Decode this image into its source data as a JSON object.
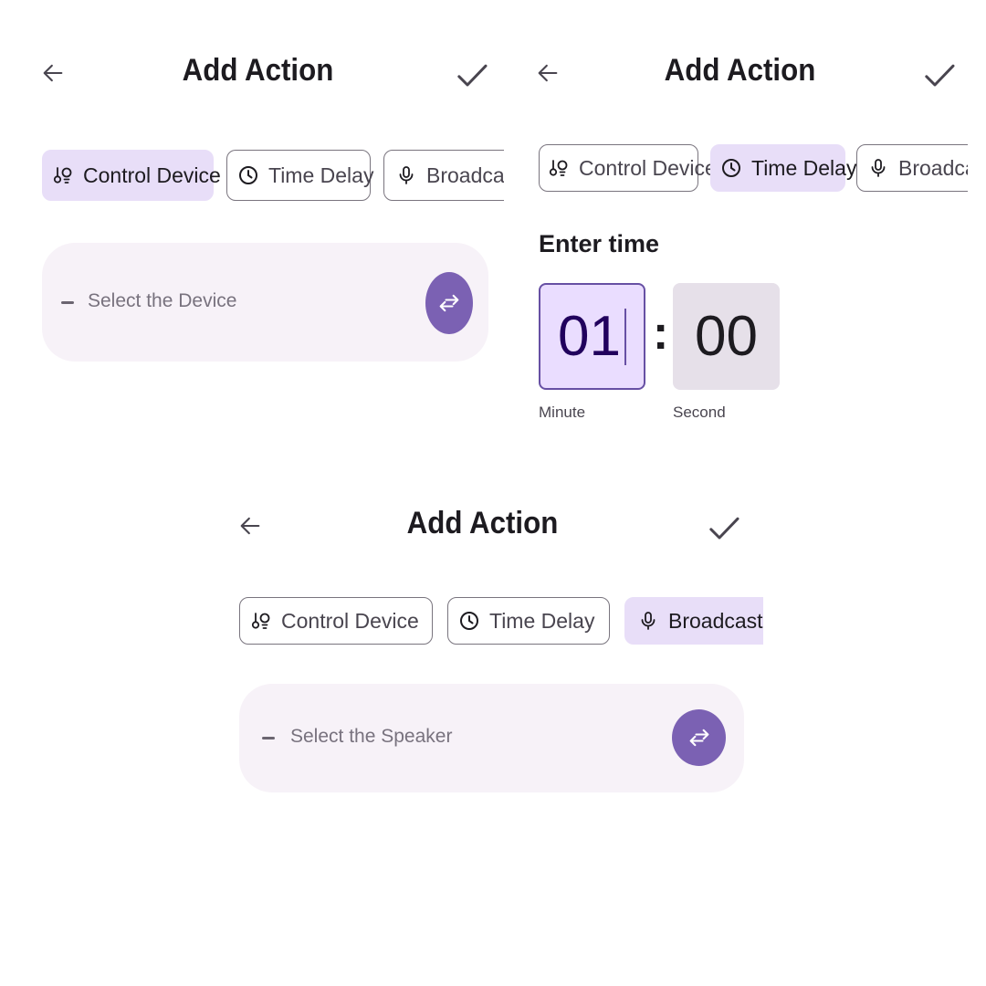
{
  "colors": {
    "chip_selected": "#e8def8",
    "fab": "#7b61b3",
    "card": "#f7f2f8",
    "time_active": "#eaddff",
    "time_inactive": "#e6e0e9"
  },
  "screens": [
    {
      "title": "Add Action",
      "back_icon": "arrow-back-icon",
      "confirm_icon": "checkmark-icon",
      "chips": [
        {
          "label": "Control Device",
          "icon": "devices-icon",
          "selected": true
        },
        {
          "label": "Time Delay",
          "icon": "clock-icon",
          "selected": false
        },
        {
          "label": "Broadcast",
          "icon": "microphone-icon",
          "selected": false
        }
      ],
      "selector": {
        "text": "Select the Device",
        "action_icon": "swap-icon"
      }
    },
    {
      "title": "Add Action",
      "back_icon": "arrow-back-icon",
      "confirm_icon": "checkmark-icon",
      "chips": [
        {
          "label": "Control Device",
          "icon": "devices-icon",
          "selected": false
        },
        {
          "label": "Time Delay",
          "icon": "clock-icon",
          "selected": true
        },
        {
          "label": "Broadcast",
          "icon": "microphone-icon",
          "selected": false
        }
      ],
      "time_entry": {
        "heading": "Enter time",
        "minute_value": "01",
        "minute_label": "Minute",
        "separator": ":",
        "second_value": "00",
        "second_label": "Second"
      }
    },
    {
      "title": "Add Action",
      "back_icon": "arrow-back-icon",
      "confirm_icon": "checkmark-icon",
      "chips": [
        {
          "label": "Control Device",
          "icon": "devices-icon",
          "selected": false
        },
        {
          "label": "Time Delay",
          "icon": "clock-icon",
          "selected": false
        },
        {
          "label": "Broadcast",
          "icon": "microphone-icon",
          "selected": true
        }
      ],
      "selector": {
        "text": "Select the Speaker",
        "action_icon": "swap-icon"
      }
    }
  ]
}
